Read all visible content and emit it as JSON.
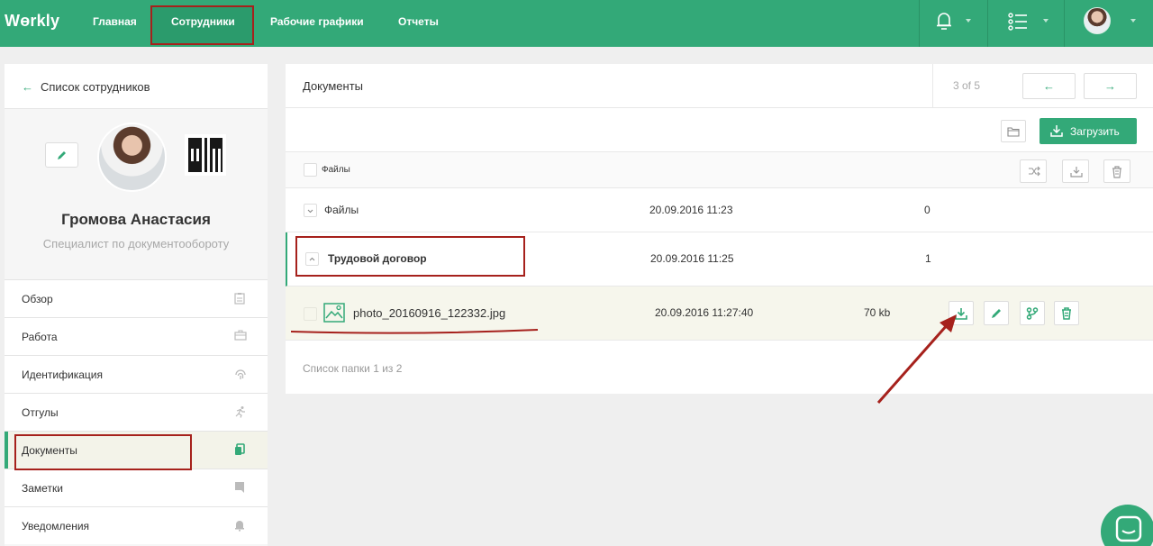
{
  "app": {
    "logo": "Wɵrkly"
  },
  "nav": {
    "items": [
      "Главная",
      "Сотрудники",
      "Рабочие графики",
      "Отчеты"
    ],
    "active": "Сотрудники"
  },
  "left": {
    "back_label": "Список сотрудников",
    "employee_name": "Громова Анастасия",
    "employee_role": "Специалист по документообороту",
    "menu": [
      {
        "label": "Обзор",
        "icon": "clipboard-icon"
      },
      {
        "label": "Работа",
        "icon": "briefcase-icon"
      },
      {
        "label": "Идентификация",
        "icon": "fingerprint-icon"
      },
      {
        "label": "Отгулы",
        "icon": "running-icon"
      },
      {
        "label": "Документы",
        "icon": "documents-icon"
      },
      {
        "label": "Заметки",
        "icon": "notes-icon"
      },
      {
        "label": "Уведомления",
        "icon": "bell-icon"
      }
    ],
    "active_menu": "Документы"
  },
  "main": {
    "title": "Документы",
    "pager": "3 of 5",
    "pager_prev": "←",
    "pager_next": "→",
    "upload_label": "Загрузить",
    "column_files": "Файлы",
    "rows": [
      {
        "name": "Файлы",
        "date": "20.09.2016 11:23",
        "count": "0"
      },
      {
        "name": "Трудовой договор",
        "date": "20.09.2016 11:25",
        "count": "1"
      }
    ],
    "file": {
      "name": "photo_20160916_122332.jpg",
      "date": "20.09.2016 11:27:40",
      "size": "70 kb"
    },
    "footer": "Список папки 1 из 2"
  },
  "colors": {
    "brand": "#33a978",
    "highlight": "#a6211c"
  }
}
